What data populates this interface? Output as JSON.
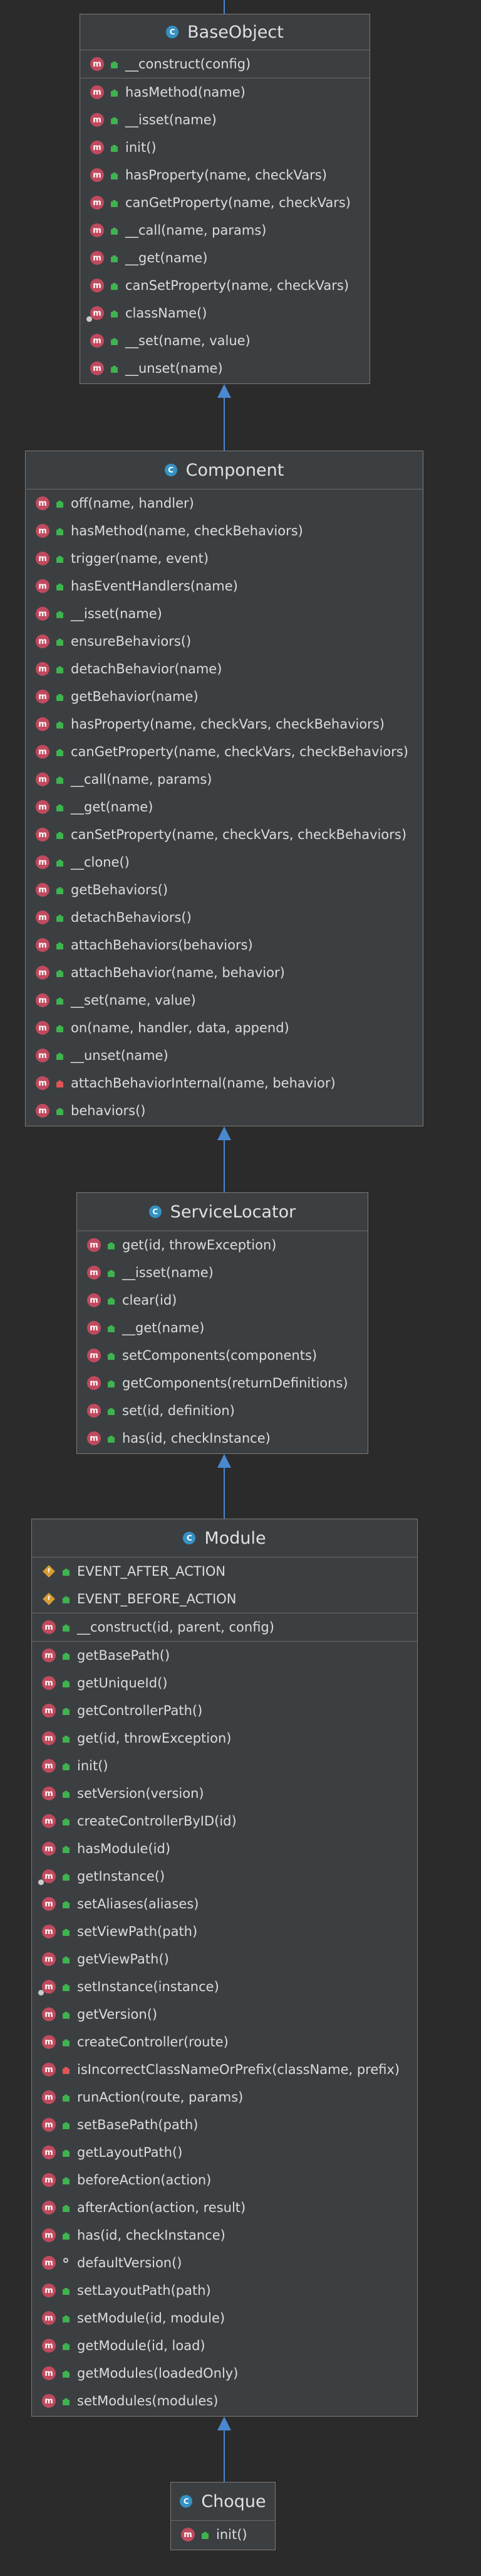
{
  "classes": [
    {
      "name": "BaseObject",
      "sections": [
        [
          {
            "label": "__construct(config)",
            "kind": "method",
            "vis": "public"
          }
        ],
        [
          {
            "label": "hasMethod(name)",
            "kind": "method",
            "vis": "public"
          },
          {
            "label": "__isset(name)",
            "kind": "method",
            "vis": "public"
          },
          {
            "label": "init()",
            "kind": "method",
            "vis": "public"
          },
          {
            "label": "hasProperty(name, checkVars)",
            "kind": "method",
            "vis": "public"
          },
          {
            "label": "canGetProperty(name, checkVars)",
            "kind": "method",
            "vis": "public"
          },
          {
            "label": "__call(name, params)",
            "kind": "method",
            "vis": "public"
          },
          {
            "label": "__get(name)",
            "kind": "method",
            "vis": "public"
          },
          {
            "label": "canSetProperty(name, checkVars)",
            "kind": "method",
            "vis": "public"
          },
          {
            "label": "className()",
            "kind": "method",
            "vis": "public",
            "static": true
          },
          {
            "label": "__set(name, value)",
            "kind": "method",
            "vis": "public"
          },
          {
            "label": "__unset(name)",
            "kind": "method",
            "vis": "public"
          }
        ]
      ]
    },
    {
      "name": "Component",
      "sections": [
        [
          {
            "label": "off(name, handler)",
            "kind": "method",
            "vis": "public"
          },
          {
            "label": "hasMethod(name, checkBehaviors)",
            "kind": "method",
            "vis": "public"
          },
          {
            "label": "trigger(name, event)",
            "kind": "method",
            "vis": "public"
          },
          {
            "label": "hasEventHandlers(name)",
            "kind": "method",
            "vis": "public"
          },
          {
            "label": "__isset(name)",
            "kind": "method",
            "vis": "public"
          },
          {
            "label": "ensureBehaviors()",
            "kind": "method",
            "vis": "public"
          },
          {
            "label": "detachBehavior(name)",
            "kind": "method",
            "vis": "public"
          },
          {
            "label": "getBehavior(name)",
            "kind": "method",
            "vis": "public"
          },
          {
            "label": "hasProperty(name, checkVars, checkBehaviors)",
            "kind": "method",
            "vis": "public"
          },
          {
            "label": "canGetProperty(name, checkVars, checkBehaviors)",
            "kind": "method",
            "vis": "public"
          },
          {
            "label": "__call(name, params)",
            "kind": "method",
            "vis": "public"
          },
          {
            "label": "__get(name)",
            "kind": "method",
            "vis": "public"
          },
          {
            "label": "canSetProperty(name, checkVars, checkBehaviors)",
            "kind": "method",
            "vis": "public"
          },
          {
            "label": "__clone()",
            "kind": "method",
            "vis": "public"
          },
          {
            "label": "getBehaviors()",
            "kind": "method",
            "vis": "public"
          },
          {
            "label": "detachBehaviors()",
            "kind": "method",
            "vis": "public"
          },
          {
            "label": "attachBehaviors(behaviors)",
            "kind": "method",
            "vis": "public"
          },
          {
            "label": "attachBehavior(name, behavior)",
            "kind": "method",
            "vis": "public"
          },
          {
            "label": "__set(name, value)",
            "kind": "method",
            "vis": "public"
          },
          {
            "label": "on(name, handler, data, append)",
            "kind": "method",
            "vis": "public"
          },
          {
            "label": "__unset(name)",
            "kind": "method",
            "vis": "public"
          },
          {
            "label": "attachBehaviorInternal(name, behavior)",
            "kind": "method",
            "vis": "private"
          },
          {
            "label": "behaviors()",
            "kind": "method",
            "vis": "public"
          }
        ]
      ]
    },
    {
      "name": "ServiceLocator",
      "sections": [
        [
          {
            "label": "get(id, throwException)",
            "kind": "method",
            "vis": "public"
          },
          {
            "label": "__isset(name)",
            "kind": "method",
            "vis": "public"
          },
          {
            "label": "clear(id)",
            "kind": "method",
            "vis": "public"
          },
          {
            "label": "__get(name)",
            "kind": "method",
            "vis": "public"
          },
          {
            "label": "setComponents(components)",
            "kind": "method",
            "vis": "public"
          },
          {
            "label": "getComponents(returnDefinitions)",
            "kind": "method",
            "vis": "public"
          },
          {
            "label": "set(id, definition)",
            "kind": "method",
            "vis": "public"
          },
          {
            "label": "has(id, checkInstance)",
            "kind": "method",
            "vis": "public"
          }
        ]
      ]
    },
    {
      "name": "Module",
      "sections": [
        [
          {
            "label": "EVENT_AFTER_ACTION",
            "kind": "constant",
            "vis": "public"
          },
          {
            "label": "EVENT_BEFORE_ACTION",
            "kind": "constant",
            "vis": "public"
          }
        ],
        [
          {
            "label": "__construct(id, parent, config)",
            "kind": "method",
            "vis": "public"
          }
        ],
        [
          {
            "label": "getBasePath()",
            "kind": "method",
            "vis": "public"
          },
          {
            "label": "getUniqueId()",
            "kind": "method",
            "vis": "public"
          },
          {
            "label": "getControllerPath()",
            "kind": "method",
            "vis": "public"
          },
          {
            "label": "get(id, throwException)",
            "kind": "method",
            "vis": "public"
          },
          {
            "label": "init()",
            "kind": "method",
            "vis": "public"
          },
          {
            "label": "setVersion(version)",
            "kind": "method",
            "vis": "public"
          },
          {
            "label": "createControllerByID(id)",
            "kind": "method",
            "vis": "public"
          },
          {
            "label": "hasModule(id)",
            "kind": "method",
            "vis": "public"
          },
          {
            "label": "getInstance()",
            "kind": "method",
            "vis": "public",
            "static": true
          },
          {
            "label": "setAliases(aliases)",
            "kind": "method",
            "vis": "public"
          },
          {
            "label": "setViewPath(path)",
            "kind": "method",
            "vis": "public"
          },
          {
            "label": "getViewPath()",
            "kind": "method",
            "vis": "public"
          },
          {
            "label": "setInstance(instance)",
            "kind": "method",
            "vis": "public",
            "static": true
          },
          {
            "label": "getVersion()",
            "kind": "method",
            "vis": "public"
          },
          {
            "label": "createController(route)",
            "kind": "method",
            "vis": "public"
          },
          {
            "label": "isIncorrectClassNameOrPrefix(className, prefix)",
            "kind": "method",
            "vis": "private"
          },
          {
            "label": "runAction(route, params)",
            "kind": "method",
            "vis": "public"
          },
          {
            "label": "setBasePath(path)",
            "kind": "method",
            "vis": "public"
          },
          {
            "label": "getLayoutPath()",
            "kind": "method",
            "vis": "public"
          },
          {
            "label": "beforeAction(action)",
            "kind": "method",
            "vis": "public"
          },
          {
            "label": "afterAction(action, result)",
            "kind": "method",
            "vis": "public"
          },
          {
            "label": "has(id, checkInstance)",
            "kind": "method",
            "vis": "public"
          },
          {
            "label": "defaultVersion()",
            "kind": "method",
            "vis": "protected"
          },
          {
            "label": "setLayoutPath(path)",
            "kind": "method",
            "vis": "public"
          },
          {
            "label": "setModule(id, module)",
            "kind": "method",
            "vis": "public"
          },
          {
            "label": "getModule(id, load)",
            "kind": "method",
            "vis": "public"
          },
          {
            "label": "getModules(loadedOnly)",
            "kind": "method",
            "vis": "public"
          },
          {
            "label": "setModules(modules)",
            "kind": "method",
            "vis": "public"
          }
        ]
      ]
    },
    {
      "name": "Choque",
      "sections": [
        [
          {
            "label": "init()",
            "kind": "method",
            "vis": "public"
          }
        ]
      ]
    }
  ],
  "icons": {
    "class": "class-icon",
    "method": "method-icon",
    "constant": "constant-icon",
    "public": "public-lock-icon",
    "private": "private-lock-icon",
    "protected": "protected-key-icon",
    "static": "static-pin-icon"
  },
  "colors": {
    "background": "#2b2b2b",
    "box": "#3c3f41",
    "class_icon": "#3592c4",
    "method_icon": "#c04a5e",
    "constant_icon": "#d79d34",
    "public": "#3fb34f",
    "private": "#e05555",
    "arrow": "#4a88d0"
  }
}
